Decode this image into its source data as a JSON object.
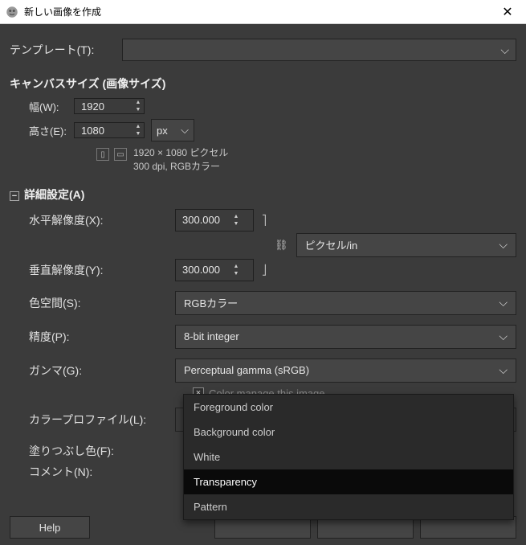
{
  "window": {
    "title": "新しい画像を作成"
  },
  "template": {
    "label": "テンプレート(T):"
  },
  "canvas": {
    "header": "キャンバスサイズ (画像サイズ)",
    "width_label": "幅(W):",
    "width_value": "1920",
    "height_label": "高さ(E):",
    "height_value": "1080",
    "unit": "px",
    "info_line1": "1920 × 1080 ピクセル",
    "info_line2": "300 dpi, RGBカラー"
  },
  "advanced": {
    "header": "詳細設定(A)",
    "xres_label": "水平解像度(X):",
    "xres_value": "300.000",
    "yres_label": "垂直解像度(Y):",
    "yres_value": "300.000",
    "res_unit": "ピクセル/in",
    "colorspace_label": "色空間(S):",
    "colorspace_value": "RGBカラー",
    "precision_label": "精度(P):",
    "precision_value": "8-bit integer",
    "gamma_label": "ガンマ(G):",
    "gamma_value": "Perceptual gamma (sRGB)",
    "colormanage_label": "Color manage this image",
    "colorprofile_label": "カラープロファイル(L):",
    "fill_label": "塗りつぶし色(F):",
    "comment_label": "コメント(N):",
    "fill_options": [
      "Foreground color",
      "Background color",
      "White",
      "Transparency",
      "Pattern"
    ],
    "fill_selected": "Transparency"
  },
  "buttons": {
    "help": "Help"
  }
}
